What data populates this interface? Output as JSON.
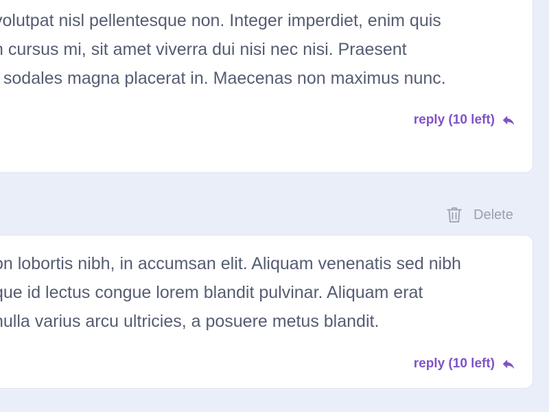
{
  "comments": [
    {
      "lines": [
        "volutpat nisl pellentesque non. Integer imperdiet, enim quis",
        "n cursus mi, sit amet viverra dui nisi nec nisi. Praesent",
        "t sodales magna placerat in. Maecenas non maximus nunc."
      ],
      "reply_label": "reply (10 left)"
    },
    {
      "delete_label": "Delete",
      "lines": [
        "on lobortis nibh, in accumsan elit. Aliquam venenatis sed nibh",
        "que id lectus congue lorem blandit pulvinar. Aliquam erat",
        "nulla varius arcu ultricies, a posuere metus blandit."
      ],
      "reply_label": "reply (10 left)"
    }
  ],
  "icons": {
    "reply": "reply-arrow-icon",
    "delete": "trash-icon"
  },
  "colors": {
    "background": "#e9eef9",
    "card": "#ffffff",
    "text": "#555d72",
    "accent": "#8052c8",
    "muted": "#9aa0ad"
  }
}
